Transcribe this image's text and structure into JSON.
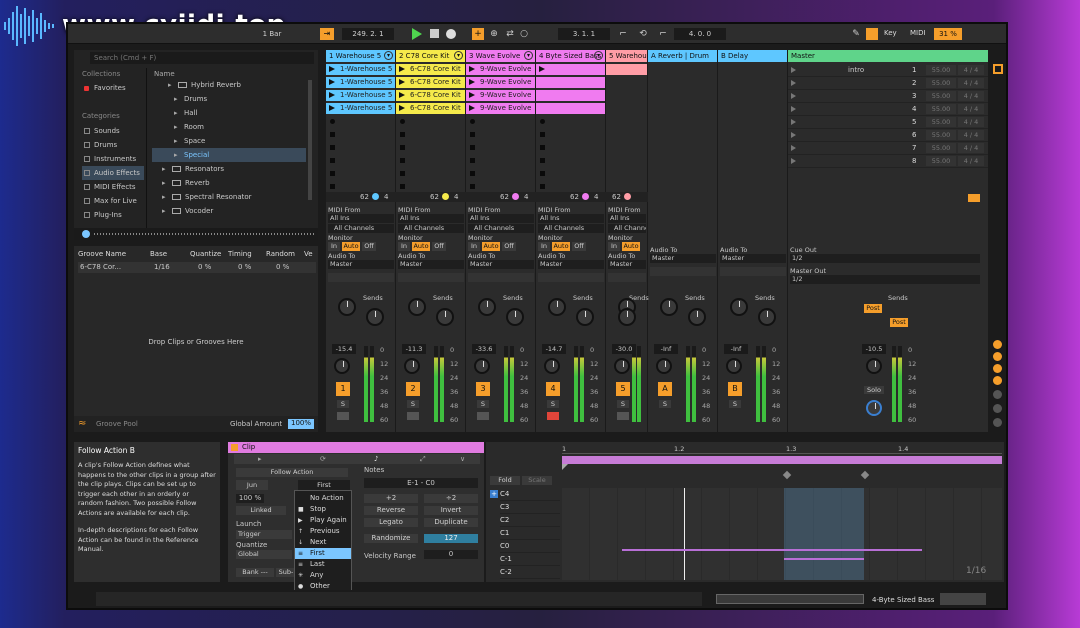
{
  "logo": {
    "text": "www.cyjidi.top"
  },
  "transport": {
    "quantize": "1 Bar",
    "position": "249.  2.  1",
    "loop_start": "3.  1.  1",
    "loop_length": "4.  0.  0",
    "key_label": "Key",
    "midi_label": "MIDI",
    "cpu": "31 %"
  },
  "browser": {
    "search_placeholder": "Search (Cmd + F)",
    "collections_header": "Collections",
    "favorites": "Favorites",
    "categories_header": "Categories",
    "categories": [
      "Sounds",
      "Drums",
      "Instruments",
      "Audio Effects",
      "MIDI Effects",
      "Max for Live",
      "Plug-Ins"
    ],
    "name_header": "Name",
    "items": [
      "Hybrid Reverb",
      "Drums",
      "Hall",
      "Room",
      "Space",
      "Special",
      "Resonators",
      "Reverb",
      "Spectral Resonator",
      "Vocoder"
    ]
  },
  "groove": {
    "headers": [
      "Groove Name",
      "Base",
      "Quantize",
      "Timing",
      "Random",
      "Ve"
    ],
    "row": {
      "name": "6-C78 Cor...",
      "base": "1/16",
      "quantize": "0 %",
      "timing": "0 %",
      "random": "0 %"
    },
    "drop_text": "Drop Clips or Grooves Here",
    "pool_label": "Groove Pool",
    "global_label": "Global Amount",
    "global_value": "100%"
  },
  "tracks": [
    {
      "name": "1 Warehouse 5",
      "color": "#5ec7ff",
      "clip": "1-Warehouse 5",
      "vol": "-15.4",
      "num": "1"
    },
    {
      "name": "2 C78 Core Kit",
      "color": "#f5ea4b",
      "clip": "6-C78 Core Kit",
      "vol": "-11.3",
      "num": "2"
    },
    {
      "name": "3 Wave Evolve",
      "color": "#f07bf0",
      "clip": "9-Wave Evolve",
      "vol": "-33.6",
      "num": "3"
    },
    {
      "name": "4 Byte Sized Bass",
      "color": "#f07bf0",
      "clip": "",
      "vol": "-14.7",
      "num": "4"
    },
    {
      "name": "5 Warehou",
      "color": "#ff9da6",
      "clip": "",
      "vol": "-30.0",
      "num": "5"
    }
  ],
  "returns": [
    {
      "name": "A Reverb | Drum",
      "color": "#5ec7ff",
      "vol": "-Inf",
      "letter": "A"
    },
    {
      "name": "B Delay",
      "color": "#5ec7ff",
      "vol": "-Inf",
      "letter": "B"
    }
  ],
  "master": {
    "name": "Master",
    "scene_name": "intro",
    "vol": "-10.5",
    "solo": "Solo",
    "cue_label": "Cue Out",
    "cue_value": "1/2",
    "master_out": "Master Out",
    "master_value": "1/2",
    "post1": "Post",
    "post2": "Post",
    "sends_label": "Sends"
  },
  "scenes": {
    "numbers": [
      "1",
      "2",
      "3",
      "4",
      "5",
      "6",
      "7",
      "8"
    ],
    "tempo": "55.00",
    "sig": "4 / 4"
  },
  "io": {
    "midi_from": "MIDI From",
    "all_ins": "All Ins",
    "all_channels": "All Channels",
    "monitor": "Monitor",
    "in": "In",
    "auto": "Auto",
    "off": "Off",
    "audio_to": "Audio To",
    "master": "Master",
    "sends": "Sends",
    "s": "S",
    "num_62": "62",
    "num_4": "4"
  },
  "info": {
    "title": "Follow Action B",
    "body": "A clip's Follow Action defines what happens to the other clips in a group after the clip plays. Clips can be set up to trigger each other in an orderly or random fashion. Two possible Follow Actions are available for each clip.",
    "body2": "In-depth descriptions for each Follow Action can be found in the Reference Manual."
  },
  "clip_panel": {
    "title": "Clip",
    "follow_action": "Follow Action",
    "jump": "Jun",
    "first": "First",
    "chance": "100 %",
    "linked": "Linked",
    "launch": "Launch",
    "trigger": "Trigger",
    "quantize": "Quantize",
    "global": "Global",
    "bank": "Bank ---",
    "sub": "Sub-",
    "notes_label": "Notes",
    "range": "E-1 - C0",
    "x2a": "+2",
    "x2b": "÷2",
    "reverse": "Reverse",
    "invert": "Invert",
    "legato": "Legato",
    "duplicate": "Duplicate",
    "randomize": "Randomize",
    "rand_value": "127",
    "vel_range": "Velocity Range",
    "vel_value": "0"
  },
  "dropdown": [
    "No Action",
    "Stop",
    "Play Again",
    "Previous",
    "Next",
    "First",
    "Last",
    "Any",
    "Other",
    "Jump"
  ],
  "dropdown_selected": "First",
  "piano_roll": {
    "fold": "Fold",
    "scale": "Scale",
    "ruler": [
      "1",
      "1.2",
      "1.3",
      "1.4"
    ],
    "keys": [
      "C4",
      "C3",
      "C2",
      "C1",
      "C0",
      "C-1",
      "C-2"
    ],
    "grid": "1/16"
  },
  "status": {
    "track_name": "4-Byte Sized Bass"
  }
}
